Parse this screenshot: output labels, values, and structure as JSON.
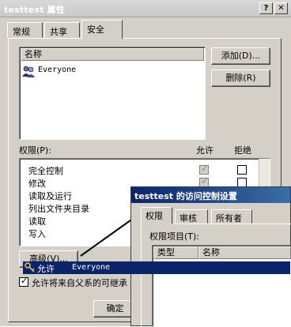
{
  "window": {
    "title": "testtest 属性",
    "help_btn": "?",
    "close_btn": "✕"
  },
  "tabs": [
    {
      "label": "常规"
    },
    {
      "label": "共享"
    },
    {
      "label": "安全"
    }
  ],
  "names": {
    "header": "名称",
    "items": [
      {
        "label": "Everyone",
        "icon": "users-icon"
      }
    ],
    "add_label": "添加(D)...",
    "remove_label": "删除(R)"
  },
  "permissions": {
    "label": "权限(P):",
    "allow_header": "允许",
    "deny_header": "拒绝",
    "rows": [
      {
        "label": "完全控制",
        "allow": true,
        "deny": false
      },
      {
        "label": "修改",
        "allow": true,
        "deny": false
      },
      {
        "label": "读取及运行",
        "allow": true,
        "deny": false
      },
      {
        "label": "列出文件夹目录",
        "allow": true,
        "deny": false
      },
      {
        "label": "读取",
        "allow": true,
        "deny": false
      },
      {
        "label": "写入",
        "allow": true,
        "deny": false
      }
    ]
  },
  "advanced_label": "高级(V)...",
  "inherit_label": "允许将来自父系的可继承",
  "ok_label": "确定",
  "popup": {
    "title": "testtest 的访问控制设置",
    "tabs": [
      {
        "label": "权限"
      },
      {
        "label": "审核"
      },
      {
        "label": "所有者"
      }
    ],
    "entries_label": "权限项目(T):",
    "col_type": "类型",
    "col_name": "名称",
    "row": {
      "type": "允许",
      "name": "Everyone"
    }
  }
}
